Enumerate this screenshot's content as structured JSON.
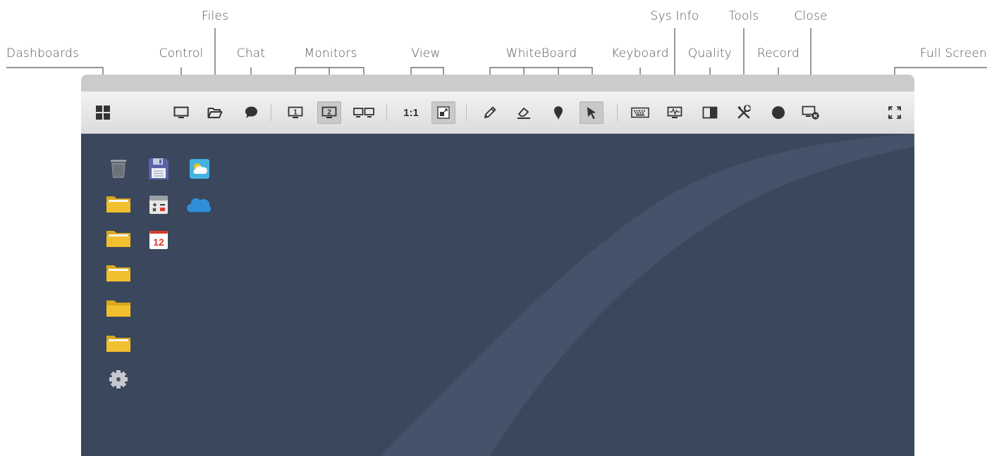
{
  "callouts": {
    "dashboards": "Dashboards",
    "control": "Control",
    "files": "Files",
    "chat": "Chat",
    "monitors": "Monitors",
    "view": "View",
    "whiteboard": "WhiteBoard",
    "keyboard": "Keyboard",
    "sys_info": "Sys Info",
    "quality": "Quality",
    "tools": "Tools",
    "record": "Record",
    "close": "Close",
    "full_screen": "Full Screen"
  },
  "toolbar": {
    "view_ratio_label": "1:1",
    "monitor_1_label": "1",
    "monitor_2_label": "2",
    "active_monitor": "2",
    "active_tool": "pointer",
    "icons": [
      "dashboards-icon",
      "control-icon",
      "files-icon",
      "chat-icon",
      "monitor-1-icon",
      "monitor-2-icon",
      "all-monitors-icon",
      "view-ratio",
      "view-scale-icon",
      "pencil-icon",
      "eraser-icon",
      "marker-icon",
      "pointer-icon",
      "keyboard-icon",
      "sys-info-icon",
      "quality-icon",
      "tools-icon",
      "record-icon",
      "close-session-icon",
      "full-screen-icon"
    ]
  },
  "desktop": {
    "calendar_day": "12",
    "icons": [
      "trash-icon",
      "floppy-disk-icon",
      "weather-icon",
      "folder-icon",
      "calculator-icon",
      "cloud-icon",
      "folder-icon",
      "calendar-icon",
      "folder-icon",
      "folder-icon",
      "folder-icon",
      "settings-gear-icon"
    ]
  },
  "colors": {
    "desktop_bg": "#3a475c",
    "toolbar_bg": "#e6e6e6",
    "titlebar": "#cbcbcb",
    "folder_yellow": "#f2c02e",
    "cloud_blue": "#2f8fd8",
    "record_dot": "#333333"
  }
}
